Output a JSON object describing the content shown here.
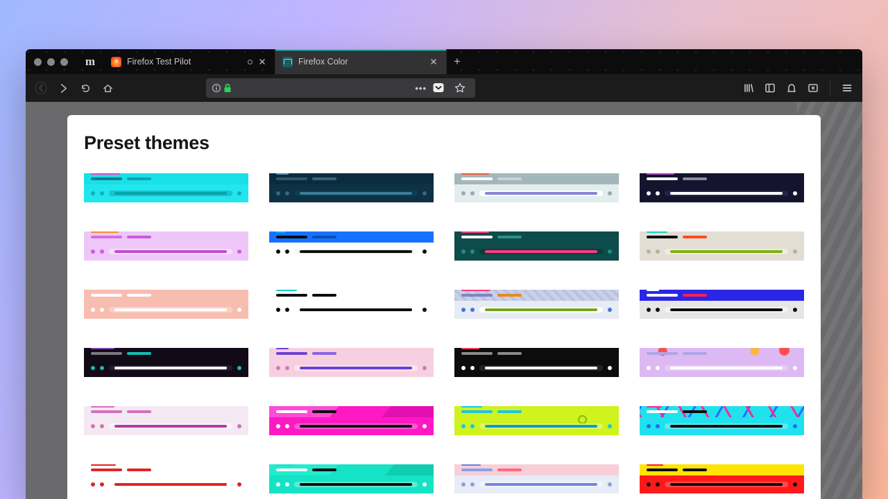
{
  "tabs": {
    "left_icon_label": "m",
    "items": [
      {
        "title": "Firefox Test Pilot",
        "active": false,
        "favicon": "mozilla",
        "loading": true
      },
      {
        "title": "Firefox Color",
        "active": true,
        "favicon": "color",
        "loading": false
      }
    ]
  },
  "page": {
    "heading": "Preset themes"
  },
  "themes": [
    {
      "top": "#18e0e9",
      "bot": "#22e5ed",
      "tabA": "#0f7f89",
      "tabB": "#12a0ac",
      "accW": 42,
      "acc": "#ff3bd1",
      "barFill": "#0aa1aa",
      "barBack": "#13c4cf",
      "dots": "#0fb0b9"
    },
    {
      "top": "#0b2c3f",
      "bot": "#0e3244",
      "tabA": "#2b5a6f",
      "tabB": "#34667c",
      "accW": 18,
      "acc": "#4e93b3",
      "barFill": "#3a7e99",
      "barBack": "#0c3b52",
      "dots": "#2c6b85"
    },
    {
      "top": "#a3b7bb",
      "bot": "#e4edee",
      "tabA": "#ffffff",
      "tabB": "#c8d4d7",
      "accW": 40,
      "acc": "#ff5a2a",
      "barFill": "#8a84d4",
      "barBack": "#ffffff",
      "dots": "#9aa9ad"
    },
    {
      "top": "#14142e",
      "bot": "#14142e",
      "tabA": "#ffffff",
      "tabB": "#8a8aa1",
      "accW": 40,
      "acc": "#b63bd0",
      "barFill": "#ffffff",
      "barBack": "#23234a",
      "dots": "#ffffff"
    },
    {
      "top": "#eec7f8",
      "bot": "#eec7f8",
      "tabA": "#d26ee3",
      "tabB": "#cc58e0",
      "accW": 40,
      "acc": "#ff8a2e",
      "barFill": "#bf4bd1",
      "barBack": "#f5dffa",
      "dots": "#cf5ce0"
    },
    {
      "top": "#1771ff",
      "bot": "#ffffff",
      "tabA": "#0c0c0d",
      "tabB": "#0a4fb0",
      "accW": 14,
      "acc": "#16a6ff",
      "barFill": "#0c0c0d",
      "barBack": "#f6f6f6",
      "dots": "#0c0c0d"
    },
    {
      "top": "#0d4c4a",
      "bot": "#0d4c4a",
      "tabA": "#ffffff",
      "tabB": "#2f8e8b",
      "accW": 40,
      "acc": "#ff3a85",
      "barFill": "#ff3a85",
      "barBack": "#0a3e3c",
      "dots": "#1e8e8c"
    },
    {
      "top": "#e3ded4",
      "bot": "#e3ded4",
      "tabA": "#0c0c0d",
      "tabB": "#ff4a1c",
      "accW": 30,
      "acc": "#14d0c0",
      "barFill": "#7fb012",
      "barBack": "#f0ece3",
      "dots": "#b7b0a2"
    },
    {
      "top": "#f8bdb1",
      "bot": "#f8bdb1",
      "tabA": "#ffffff",
      "tabB": "#ffffff",
      "accW": 0,
      "acc": "#ffffff",
      "barFill": "#ffffff",
      "barBack": "#fccfc6",
      "dots": "#ffffff"
    },
    {
      "top": "#ffffff",
      "bot": "#ffffff",
      "tabA": "#0c0c0d",
      "tabB": "#0c0c0d",
      "accW": 30,
      "acc": "#14d0c0",
      "barFill": "#0c0c0d",
      "barBack": "#ffffff",
      "dots": "#0c0c0d",
      "border": "#d7d7d7"
    },
    {
      "top": "#c9d0e8",
      "bot": "#e7ebf5",
      "tabA": "#7b87c2",
      "tabB": "#e78a1c",
      "accW": 42,
      "acc": "#ff3a85",
      "barFill": "#77a517",
      "barBack": "#ffffff",
      "dots": "#3c78d8",
      "bg": "pattern-geo"
    },
    {
      "top": "#2a26e6",
      "bot": "#e6e6e6",
      "tabA": "#ffffff",
      "tabB": "#ff2052",
      "accW": 18,
      "acc": "#ffffff",
      "barFill": "#0c0c0d",
      "barBack": "#f2f2f2",
      "dots": "#0c0c0d"
    },
    {
      "top": "#120b17",
      "bot": "#120b17",
      "tabA": "#7a7a7f",
      "tabB": "#16bdb2",
      "accW": 34,
      "acc": "#7b3fa8",
      "barFill": "#ffffff",
      "barBack": "#241b2c",
      "dots": "#1cb8b0"
    },
    {
      "top": "#f6d0e0",
      "bot": "#f6d0e0",
      "tabA": "#6b42d6",
      "tabB": "#8b62e6",
      "accW": 18,
      "acc": "#6b42d6",
      "barFill": "#6b42d6",
      "barBack": "#fbe4ee",
      "dots": "#d27ab8",
      "border": "#edbdd3"
    },
    {
      "top": "#0c0c0d",
      "bot": "#0c0c0d",
      "tabA": "#8b8b8f",
      "tabB": "#8b8b8f",
      "accW": 26,
      "acc": "#ff3a55",
      "barFill": "#ffffff",
      "barBack": "#232325",
      "dots": "#ffffff"
    },
    {
      "top": "#dcb9f2",
      "bot": "#dcb9f2",
      "tabA": "#afa5e6",
      "tabB": "#afa5e6",
      "accW": 0,
      "acc": "#ffffff",
      "barFill": "#ffffff",
      "barBack": "#e7cdf6",
      "dots": "#ffffff",
      "bg": "candy"
    },
    {
      "top": "#f4e9f3",
      "bot": "#f4e9f3",
      "tabA": "#d46fbd",
      "tabB": "#d46fbd",
      "accW": 34,
      "acc": "#d46fbd",
      "barFill": "#b03ea0",
      "barBack": "#fbf3fa",
      "dots": "#d46fbd",
      "border": "#e8d7e6"
    },
    {
      "top": "#ff19c5",
      "bot": "#ff19c5",
      "tabA": "#ffffff",
      "tabB": "#0c0c0d",
      "accW": 0,
      "acc": "#ffffff",
      "barFill": "#0c0c0d",
      "barBack": "#ff57d4",
      "dots": "#ffffff",
      "bg": "poly-magenta",
      "border": "#ff19c5"
    },
    {
      "top": "#cef31d",
      "bot": "#cef31d",
      "tabA": "#18c7e8",
      "tabB": "#18c7e8",
      "accW": 30,
      "acc": "#18c7e8",
      "barFill": "#0a9fc4",
      "barBack": "#def85e",
      "dots": "#18c7e8",
      "extra": "sun"
    },
    {
      "top": "#1fe2ee",
      "bot": "#1fe2ee",
      "tabA": "#ffffff",
      "tabB": "#0c0c0d",
      "accW": 22,
      "acc": "#ff2a8d",
      "barFill": "#0c0c0d",
      "barBack": "#5ceaf2",
      "dots": "#1b6fff",
      "bg": "bolts"
    },
    {
      "top": "#ffffff",
      "bot": "#ffffff",
      "tabA": "#e02424",
      "tabB": "#e02424",
      "accW": 36,
      "acc": "#e02424",
      "barFill": "#e02424",
      "barBack": "#ffffff",
      "dots": "#e02424",
      "border": "#dcdcdc"
    },
    {
      "top": "#14e3c5",
      "bot": "#14e3c5",
      "tabA": "#ffffff",
      "tabB": "#0c0c0d",
      "accW": 26,
      "acc": "#14e3c5",
      "barFill": "#0c0c0d",
      "barBack": "#5cead6",
      "dots": "#ffffff",
      "bg": "poly-teal"
    },
    {
      "top": "#f6cfd9",
      "bot": "#e7ecf7",
      "tabA": "#8aa0e8",
      "tabB": "#ff6a79",
      "accW": 28,
      "acc": "#6b7ddb",
      "barFill": "#7387e0",
      "barBack": "#f2f4fb",
      "dots": "#8aa0e8"
    },
    {
      "top": "#ffe400",
      "bot": "#ff1a1a",
      "tabA": "#0c0c0d",
      "tabB": "#0c0c0d",
      "accW": 24,
      "acc": "#ff1a1a",
      "barFill": "#0c0c0d",
      "barBack": "#ff4a4a",
      "dots": "#0c0c0d"
    }
  ]
}
